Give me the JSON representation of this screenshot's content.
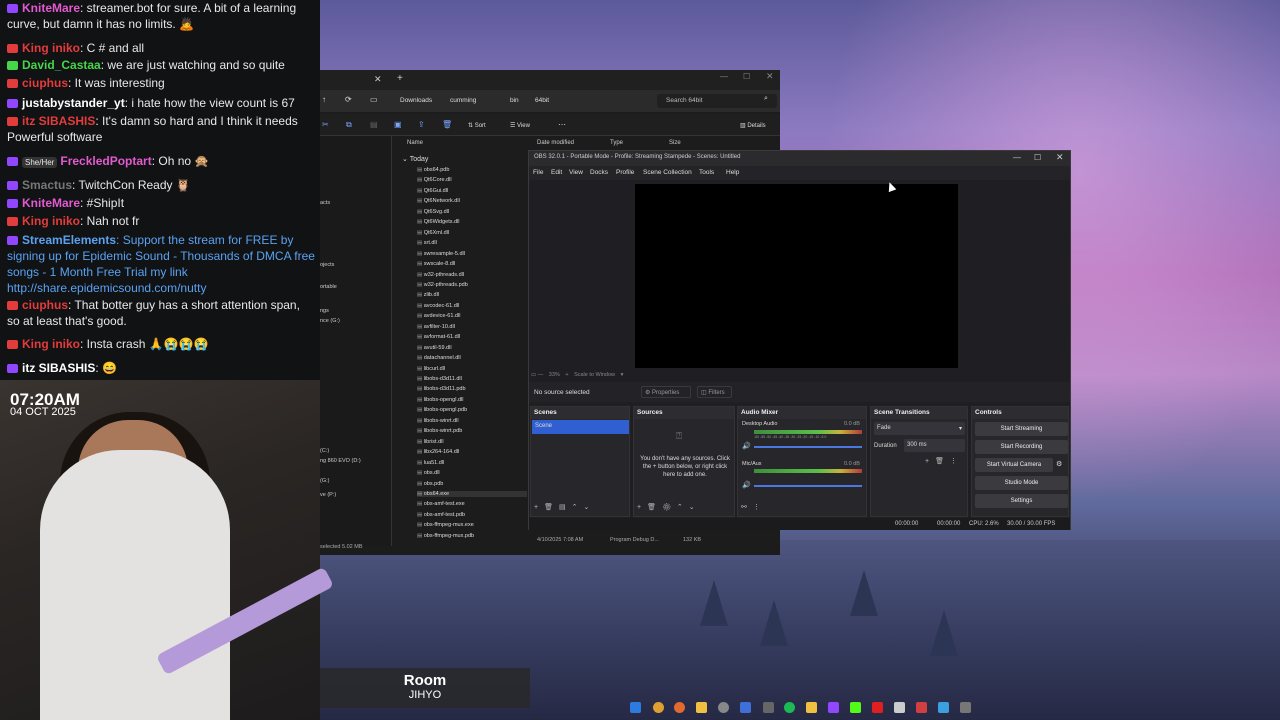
{
  "chat": {
    "messages": [
      {
        "user": "KniteMare",
        "text": ": streamer.bot for sure. A bit of a learning curve, but damn it has no limits. 🙇",
        "color": "#e25ad0"
      },
      {
        "user": "King iniko",
        "text": ": C # and all",
        "color": "#e33c3c"
      },
      {
        "user": "David_Castaa",
        "text": ": we are just watching and so quite",
        "color": "#45d64a"
      },
      {
        "user": "ciuphus",
        "text": ": It was interesting",
        "color": "#e33c3c"
      },
      {
        "user": "justabystander_yt",
        "text": ": i hate how the view count is 67",
        "color": "#ffffff"
      },
      {
        "user": "itz SIBASHIS",
        "text": ": It's damn so hard and I think it needs Powerful software",
        "color": "#e33c3c"
      },
      {
        "user": "FreckledPoptart",
        "text": ": Oh no 🙊",
        "color": "#e25ad0",
        "tag": "She/Her"
      },
      {
        "user": "Smactus",
        "text": ": TwitchCon Ready 🦉",
        "color": "#777777"
      },
      {
        "user": "KniteMare",
        "text": ": #ShipIt",
        "color": "#e25ad0"
      },
      {
        "user": "King iniko",
        "text": ": Nah not fr",
        "color": "#e33c3c"
      },
      {
        "user": "StreamElements",
        "text": ": Support the stream for FREE by signing up for Epidemic Sound - Thousands of DMCA free songs - 1 Month Free Trial my link http://share.epidemicsound.com/nutty",
        "color": "#5aa2f0"
      },
      {
        "user": "ciuphus",
        "text": ": That botter guy has a short attention span, so at least that's good.",
        "color": "#e33c3c"
      },
      {
        "user": "King iniko",
        "text": ": Insta crash 🙏😭😭😭",
        "color": "#e33c3c"
      },
      {
        "user": "itz SIBASHIS",
        "text": ": 😄",
        "color": "#ffffff"
      }
    ]
  },
  "overlay": {
    "time": "07:20AM",
    "date": "04 OCT 2025",
    "room_title": "Room",
    "room_sub": "JIHYO"
  },
  "explorer": {
    "breadcrumbs": [
      "Downloads",
      "cumming",
      "bin",
      "64bit"
    ],
    "search_placeholder": "Search 64bit",
    "sort_label": "Sort",
    "view_label": "View",
    "details_label": "Details",
    "col_name": "Name",
    "col_date": "Date modified",
    "col_type": "Type",
    "col_size": "Size",
    "group": "Today",
    "files": [
      "obs64.pdb",
      "Qt6Core.dll",
      "Qt6Gui.dll",
      "Qt6Network.dll",
      "Qt6Svg.dll",
      "Qt6Widgets.dll",
      "Qt6Xml.dll",
      "srt.dll",
      "swresample-5.dll",
      "swscale-8.dll",
      "w32-pthreads.dll",
      "w32-pthreads.pdb",
      "zlib.dll",
      "avcodec-61.dll",
      "avdevice-61.dll",
      "avfilter-10.dll",
      "avformat-61.dll",
      "avutil-59.dll",
      "datachannel.dll",
      "libcurl.dll",
      "libobs-d3d11.dll",
      "libobs-d3d11.pdb",
      "libobs-opengl.dll",
      "libobs-opengl.pdb",
      "libobs-winrt.dll",
      "libobs-winrt.pdb",
      "librist.dll",
      "libx264-164.dll",
      "lua51.dll",
      "obs.dll",
      "obs.pdb",
      "obs64.exe",
      "obs-amf-test.exe",
      "obs-amf-test.pdb",
      "obs-ffmpeg-mux.exe",
      "obs-ffmpeg-mux.pdb"
    ],
    "selected_row": "4/10/2025 7:08 AM",
    "selected_type": "Program Debug D...",
    "selected_size": "132 KB",
    "status": "selected 5.02 MB"
  },
  "obs": {
    "title": "OBS 32.0.1 - Portable Mode - Profile: Streaming Stampede - Scenes: Untitled",
    "menu": [
      "File",
      "Edit",
      "View",
      "Docks",
      "Profile",
      "Scene Collection",
      "Tools",
      "Help"
    ],
    "zoom": "33%",
    "scale": "Scale to Window",
    "no_source": "No source selected",
    "properties": "Properties",
    "filters": "Filters",
    "scenes_title": "Scenes",
    "scene_item": "Scene",
    "sources_title": "Sources",
    "sources_empty": "You don't have any sources. Click the + button below, or right click here to add one.",
    "mixer_title": "Audio Mixer",
    "ch1": "Desktop Audio",
    "ch1_db": "0.0 dB",
    "ch2": "Mic/Aux",
    "ch2_db": "0.0 dB",
    "ticks": "-60 -55 -50 -45 -40 -35 -30 -25 -20 -15 -10 -5 0",
    "transitions_title": "Scene Transitions",
    "transition": "Fade",
    "duration_label": "Duration",
    "duration": "300 ms",
    "controls_title": "Controls",
    "controls": [
      "Start Streaming",
      "Start Recording",
      "Start Virtual Camera",
      "Studio Mode",
      "Settings"
    ],
    "status_t1": "00:00:00",
    "status_t2": "00:00:00",
    "cpu": "CPU: 2.6%",
    "fps": "30.00 / 30.00 FPS"
  }
}
